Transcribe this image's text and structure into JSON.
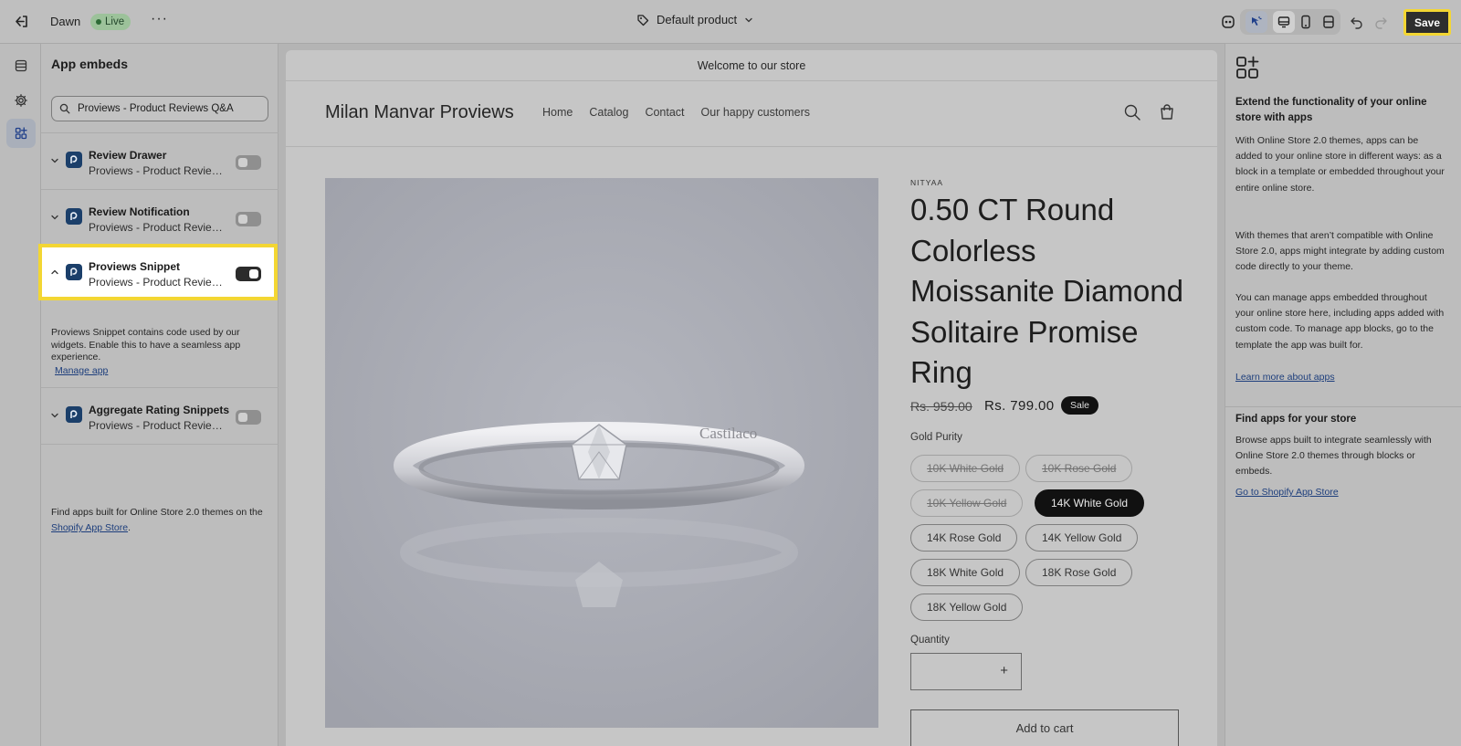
{
  "topbar": {
    "theme_name": "Dawn",
    "live_label": "Live",
    "more_label": "···",
    "template_label": "Default product",
    "save_label": "Save"
  },
  "sidebar": {
    "title": "App embeds",
    "search_value": "Proviews - Product Reviews Q&A",
    "embeds": [
      {
        "name": "Review Drawer",
        "sub": "Proviews - Product Reviews Q&A",
        "enabled": false
      },
      {
        "name": "Review Notification",
        "sub": "Proviews - Product Reviews Q&A",
        "enabled": false
      },
      {
        "name": "Proviews Snippet",
        "sub": "Proviews - Product Reviews Q&A",
        "enabled": true
      },
      {
        "name": "Aggregate Rating Snippets",
        "sub": "Proviews - Product Reviews Q&A",
        "enabled": false
      }
    ],
    "snippet_desc": "Proviews Snippet contains code used by our widgets. Enable this to have a seamless app experience.",
    "manage_app": "Manage app",
    "footer_text": "Find apps built for Online Store 2.0 themes on the",
    "footer_link": "Shopify App Store",
    "footer_end": "."
  },
  "preview": {
    "announcement": "Welcome to our store",
    "store_name": "Milan Manvar Proviews",
    "nav": [
      "Home",
      "Catalog",
      "Contact",
      "Our happy customers"
    ],
    "watermark": "Castilaco",
    "vendor": "NITYAA",
    "title": "0.50 CT Round Colorless Moissanite Diamond Solitaire Promise Ring",
    "price_old": "Rs. 959.00",
    "price_new": "Rs. 799.00",
    "sale_badge": "Sale",
    "option_label": "Gold Purity",
    "options": [
      {
        "label": "10K White Gold",
        "state": "disabled"
      },
      {
        "label": "10K Rose Gold",
        "state": "disabled"
      },
      {
        "label": "10K Yellow Gold",
        "state": "disabled"
      },
      {
        "label": "14K White Gold",
        "state": "selected"
      },
      {
        "label": "14K Rose Gold",
        "state": "normal"
      },
      {
        "label": "14K Yellow Gold",
        "state": "normal"
      },
      {
        "label": "18K White Gold",
        "state": "normal"
      },
      {
        "label": "18K Rose Gold",
        "state": "normal"
      },
      {
        "label": "18K Yellow Gold",
        "state": "normal"
      }
    ],
    "quantity_label": "Quantity",
    "qty_plus": "+",
    "add_to_cart": "Add to cart"
  },
  "right_panel": {
    "heading1": "Extend the functionality of your online store with apps",
    "para1": "With Online Store 2.0 themes, apps can be added to your online store in different ways: as a block in a template or embedded throughout your entire online store.",
    "para2": "With themes that aren’t compatible with Online Store 2.0, apps might integrate by adding custom code directly to your theme.",
    "para3": "You can manage apps embedded throughout your online store here, including apps added with custom code. To manage app blocks, go to the template the app was built for.",
    "link1": "Learn more about apps",
    "heading2": "Find apps for your store",
    "para4": "Browse apps built to integrate seamlessly with Online Store 2.0 themes through blocks or embeds.",
    "link2": "Go to Shopify App Store"
  },
  "colors": {
    "highlight": "#f3d633",
    "live_badge": "#9cc29a",
    "app_icon": "#1b3f6a",
    "link": "#1d3e7c"
  }
}
